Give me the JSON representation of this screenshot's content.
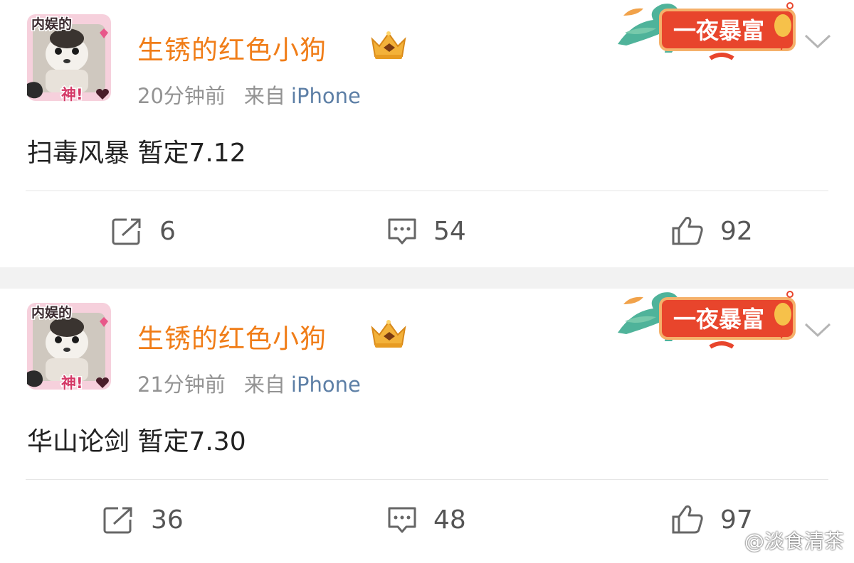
{
  "posts": [
    {
      "username": "生锈的红色小狗",
      "avatar_labels": {
        "top": "内娱的",
        "bottom": "神!"
      },
      "time": "20分钟前",
      "source_label": "来自",
      "device": "iPhone",
      "badge_text": "一夜暴富",
      "content": "扫毒风暴 暂定7.12",
      "reposts": "6",
      "comments": "54",
      "likes": "92"
    },
    {
      "username": "生锈的红色小狗",
      "avatar_labels": {
        "top": "内娱的",
        "bottom": "神!"
      },
      "time": "21分钟前",
      "source_label": "来自",
      "device": "iPhone",
      "badge_text": "一夜暴富",
      "content": "华山论剑 暂定7.30",
      "reposts": "36",
      "comments": "48",
      "likes": "97"
    }
  ],
  "watermark": "@淡食清茶",
  "icons": {
    "repost": "repost-icon",
    "comment": "comment-icon",
    "like": "like-icon",
    "menu": "chevron-down-icon",
    "vip": "crown-icon"
  },
  "colors": {
    "username": "#f07d18",
    "device": "#5d7fa6",
    "meta": "#939393",
    "badge": "#e8452c",
    "separator": "#f2f2f2"
  }
}
